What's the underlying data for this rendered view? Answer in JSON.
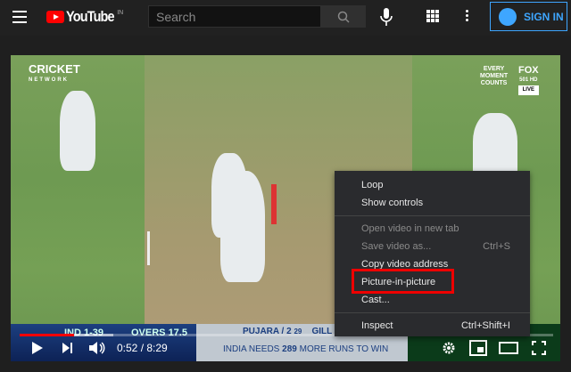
{
  "header": {
    "logo_text": "YouTube",
    "region": "IN",
    "search_placeholder": "Search",
    "sign_in": "SIGN IN"
  },
  "video": {
    "overlay": {
      "broadcaster": "CRICKET",
      "broadcaster_sub": "NETWORK",
      "tagline": [
        "EVERY",
        "MOMENT",
        "COUNTS"
      ],
      "channel": "FOX",
      "channel_sub": "501 HD",
      "live": "LIVE"
    },
    "score": {
      "team_score": "IND 1-39",
      "overs": "OVERS 17.5",
      "batsman1": "PUJARA / 2",
      "batsman1_balls": "29",
      "batsman2": "GILL",
      "message_pre": "INDIA NEEDS",
      "runs": "289",
      "message_post": "MORE RUNS TO WIN"
    },
    "player": {
      "current_time": "0:52",
      "duration": "8:29",
      "time_display": "0:52 / 8:29",
      "progress_percent": 10.2,
      "buffered_percent": 17.5,
      "play_color": "#ff0000"
    }
  },
  "context_menu": {
    "items": [
      {
        "label": "Loop",
        "shortcut": "",
        "enabled": true
      },
      {
        "label": "Show controls",
        "shortcut": "",
        "enabled": true
      },
      {
        "label": "Open video in new tab",
        "shortcut": "",
        "enabled": false
      },
      {
        "label": "Save video as...",
        "shortcut": "Ctrl+S",
        "enabled": false
      },
      {
        "label": "Copy video address",
        "shortcut": "",
        "enabled": true
      },
      {
        "label": "Picture-in-picture",
        "shortcut": "",
        "enabled": true,
        "highlighted": true
      },
      {
        "label": "Cast...",
        "shortcut": "",
        "enabled": true
      },
      {
        "label": "Inspect",
        "shortcut": "Ctrl+Shift+I",
        "enabled": true
      }
    ],
    "highlight_color": "#e00000"
  }
}
